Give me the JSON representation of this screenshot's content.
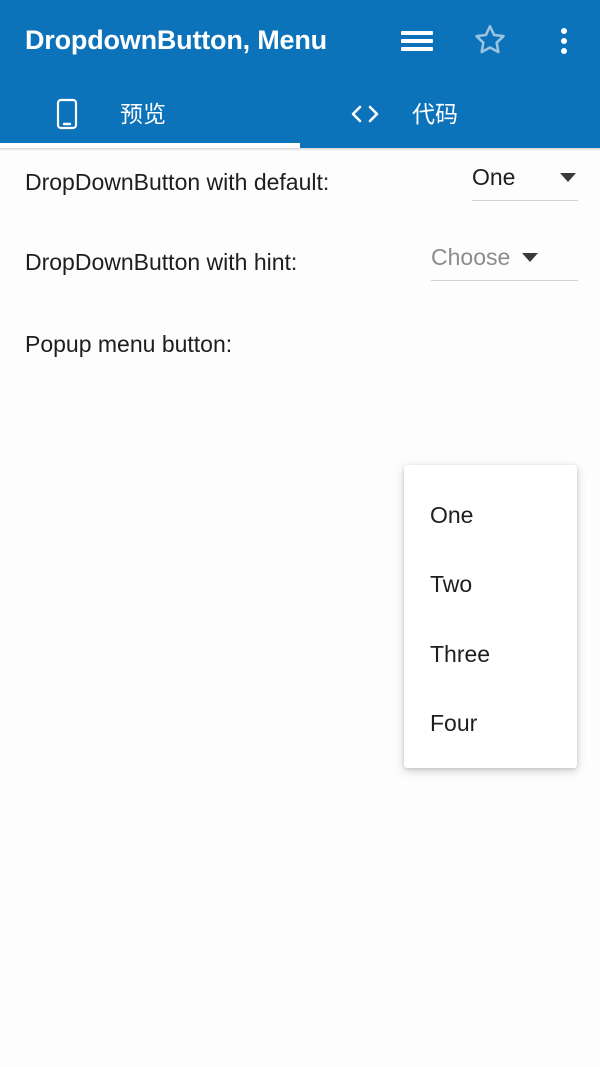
{
  "app_bar": {
    "title": "DropdownButton, Menu",
    "background_color": "#0c72ba",
    "actions": [
      {
        "name": "hamburger-menu",
        "label": "菜单"
      },
      {
        "name": "star-favorite",
        "label": "收藏"
      },
      {
        "name": "overflow-menu",
        "label": "更多"
      }
    ]
  },
  "tabs": [
    {
      "label": "预览",
      "icon": "phone-icon",
      "selected": true
    },
    {
      "label": "代码",
      "icon": "code-brackets-icon",
      "selected": false
    }
  ],
  "content": {
    "rows": [
      {
        "label": "DropDownButton with default:",
        "control": "dropdown",
        "value": "One",
        "is_hint": false
      },
      {
        "label": "DropDownButton with hint:",
        "control": "dropdown",
        "value": "Choose",
        "is_hint": true
      },
      {
        "label": "Popup menu button:",
        "control": "popup-menu",
        "value": "",
        "is_hint": false
      }
    ]
  },
  "popup_menu": {
    "open": true,
    "items": [
      {
        "label": "One"
      },
      {
        "label": "Two"
      },
      {
        "label": "Three"
      },
      {
        "label": "Four"
      }
    ]
  },
  "colors": {
    "primary": "#0c72ba",
    "on_primary": "#ffffff",
    "body_background": "#fdfdfd",
    "text_primary": "#1e1e1e",
    "text_hint": "#8c8c8c",
    "divider": "#d2d2d2"
  }
}
